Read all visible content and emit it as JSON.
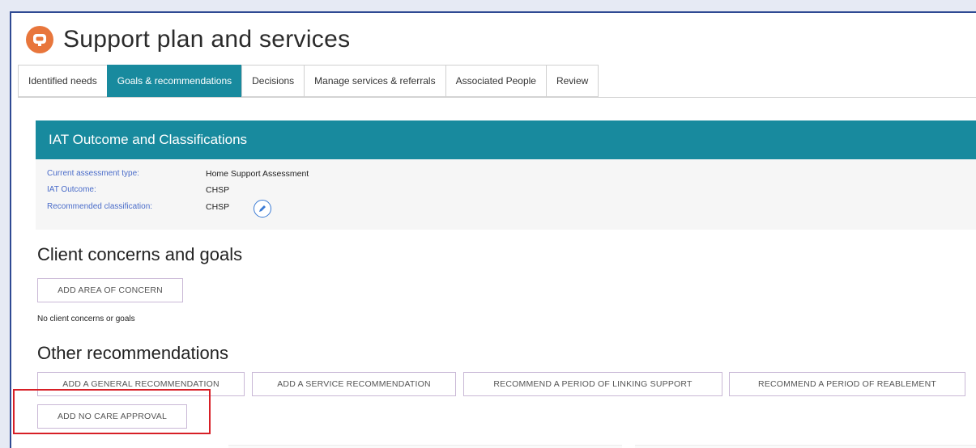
{
  "page": {
    "title": "Support plan and services"
  },
  "tabs": [
    {
      "label": "Identified needs",
      "active": false
    },
    {
      "label": "Goals & recommendations",
      "active": true
    },
    {
      "label": "Decisions",
      "active": false
    },
    {
      "label": "Manage services & referrals",
      "active": false
    },
    {
      "label": "Associated People",
      "active": false
    },
    {
      "label": "Review",
      "active": false
    }
  ],
  "iat_panel": {
    "title": "IAT Outcome and Classifications",
    "rows": [
      {
        "label": "Current assessment type:",
        "value": "Home Support Assessment"
      },
      {
        "label": "IAT Outcome:",
        "value": "CHSP"
      },
      {
        "label": "Recommended classification:",
        "value": "CHSP"
      }
    ]
  },
  "client_concerns": {
    "heading": "Client concerns and goals",
    "add_button": "ADD AREA OF CONCERN",
    "empty_text": "No client concerns or goals"
  },
  "other_recommendations": {
    "heading": "Other recommendations",
    "buttons": [
      "ADD A GENERAL RECOMMENDATION",
      "ADD A SERVICE RECOMMENDATION",
      "RECOMMEND A PERIOD OF LINKING SUPPORT",
      "RECOMMEND A PERIOD OF REABLEMENT",
      "ADD NO CARE APPROVAL"
    ]
  },
  "colors": {
    "accent": "#188a9e",
    "app_icon": "#e8763c",
    "highlight_box": "#d71f26",
    "label_blue": "#4a6cc9"
  },
  "icons": {
    "app": "app-logo-icon",
    "edit": "pencil-icon"
  }
}
